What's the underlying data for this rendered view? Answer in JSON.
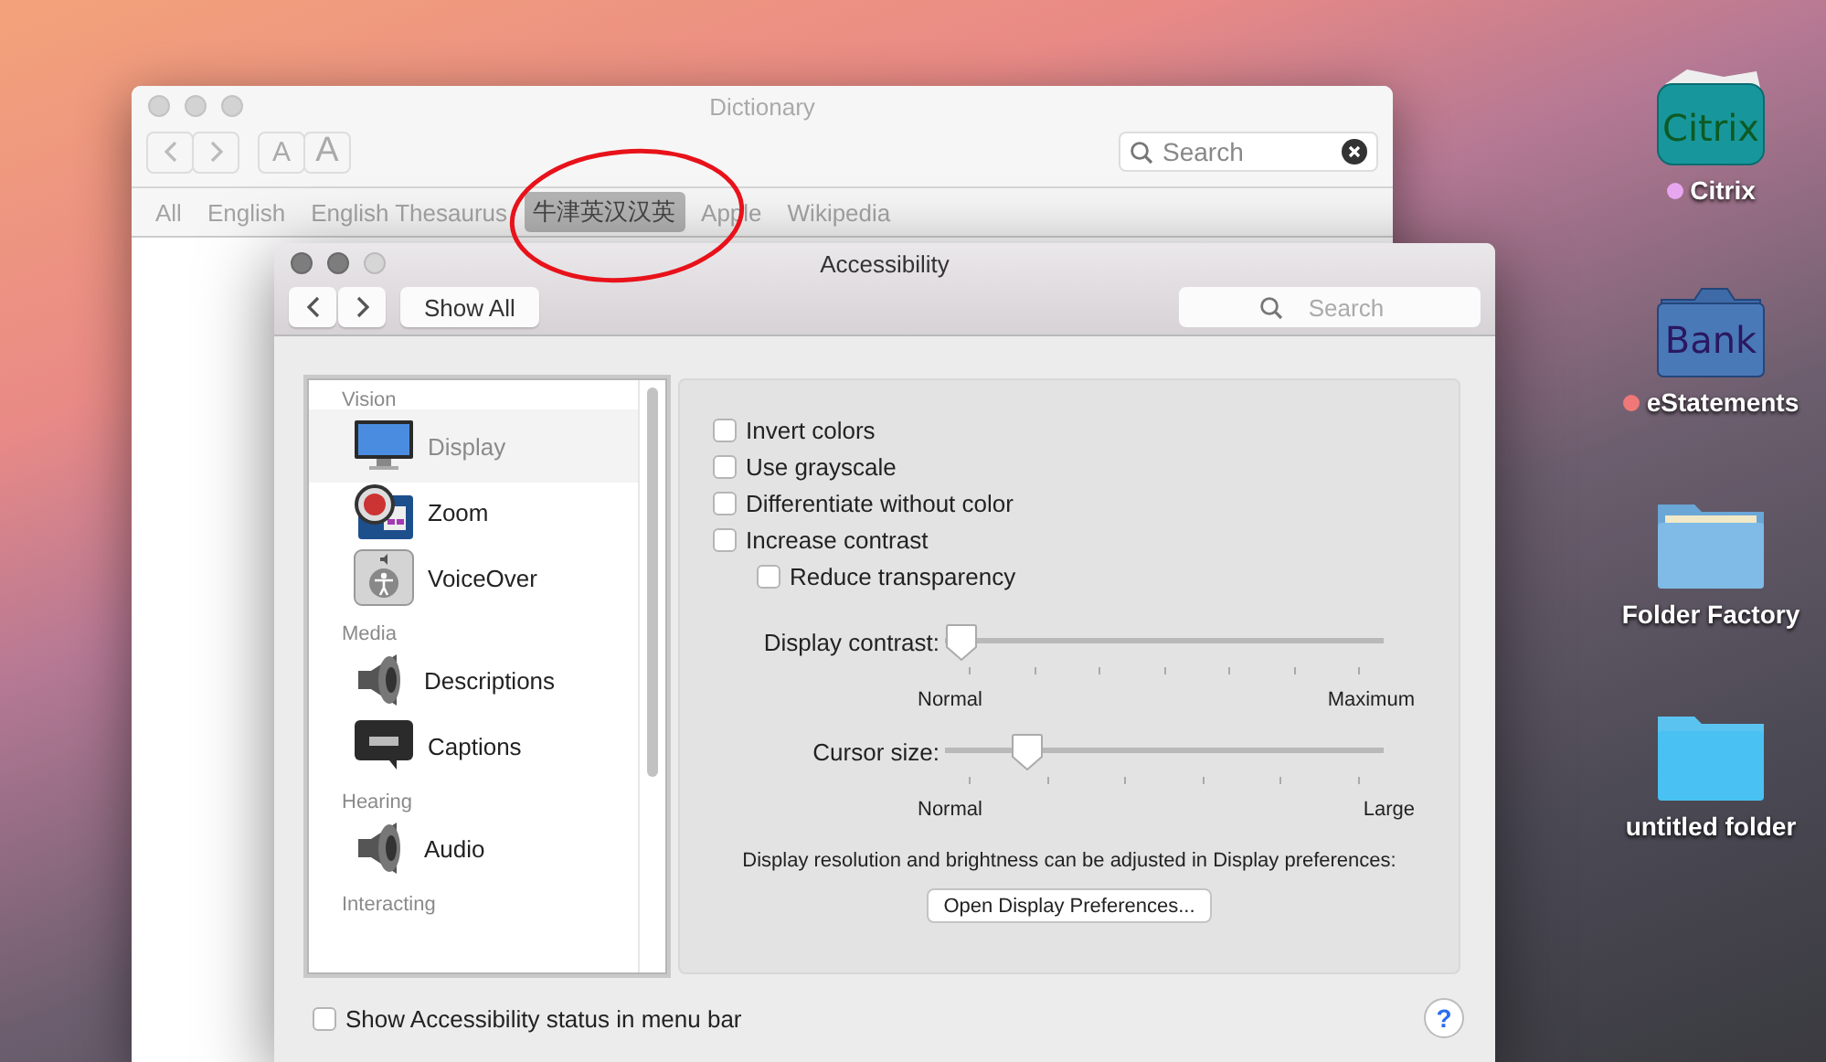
{
  "desktop_items": [
    {
      "label": "Citrix",
      "kind": "citrix",
      "icon_text": "Citrix",
      "color": "#e9a6f0"
    },
    {
      "label": "eStatements",
      "kind": "bank",
      "icon_text": "Bank",
      "color": "#f07878"
    },
    {
      "label": "Folder Factory",
      "kind": "folder"
    },
    {
      "label": "untitled folder",
      "kind": "plain-folder"
    }
  ],
  "dictionary": {
    "title": "Dictionary",
    "font_buttons": [
      "A",
      "A"
    ],
    "search": {
      "placeholder": "Search"
    },
    "sources": [
      {
        "label": "All",
        "selected": false
      },
      {
        "label": "English",
        "selected": false
      },
      {
        "label": "English Thesaurus",
        "selected": false
      },
      {
        "label": "牛津英汉汉英",
        "selected": true
      },
      {
        "label": "Apple",
        "selected": false
      },
      {
        "label": "Wikipedia",
        "selected": false
      }
    ]
  },
  "accessibility": {
    "title": "Accessibility",
    "show_all": "Show All",
    "search": {
      "placeholder": "Search"
    },
    "sidebar": {
      "groups": [
        {
          "heading": "Vision",
          "items": [
            {
              "label": "Display",
              "kind": "monitor",
              "selected": true
            },
            {
              "label": "Zoom",
              "kind": "zoom",
              "selected": false
            },
            {
              "label": "VoiceOver",
              "kind": "voiceover",
              "selected": false
            }
          ]
        },
        {
          "heading": "Media",
          "items": [
            {
              "label": "Descriptions",
              "kind": "speaker",
              "selected": false
            },
            {
              "label": "Captions",
              "kind": "captions",
              "selected": false
            }
          ]
        },
        {
          "heading": "Hearing",
          "items": [
            {
              "label": "Audio",
              "kind": "speaker",
              "selected": false
            }
          ]
        },
        {
          "heading": "Interacting"
        }
      ]
    },
    "options": [
      {
        "label": "Invert colors",
        "checked": false
      },
      {
        "label": "Use grayscale",
        "checked": false
      },
      {
        "label": "Differentiate without color",
        "checked": false
      },
      {
        "label": "Increase contrast",
        "checked": false,
        "children": [
          {
            "label": "Reduce transparency",
            "checked": false
          }
        ]
      }
    ],
    "sliders": [
      {
        "label": "Display contrast:",
        "level": 0.0,
        "min_label": "Normal",
        "max_label": "Maximum"
      },
      {
        "label": "Cursor size:",
        "level": 0.16,
        "min_label": "Normal",
        "max_label": "Large"
      }
    ],
    "note": "Display resolution and brightness can be adjusted in Display preferences:",
    "open_button": "Open Display Preferences...",
    "status_option": {
      "label": "Show Accessibility status in menu bar",
      "checked": false
    },
    "help": "?"
  }
}
